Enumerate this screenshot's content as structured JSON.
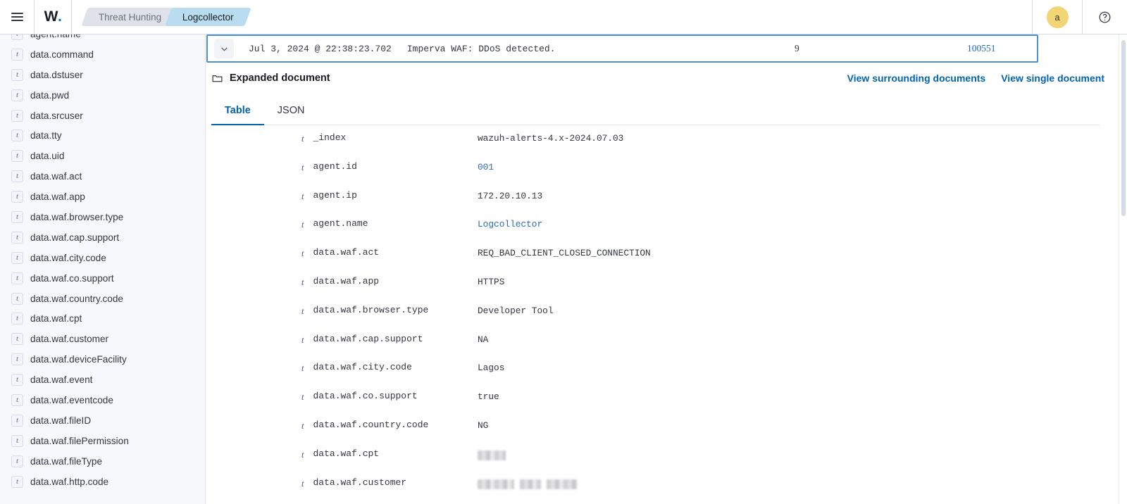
{
  "topbar": {
    "menu_icon": "hamburger-icon",
    "logo_text": "W",
    "logo_dot": ".",
    "breadcrumbs": [
      {
        "label": "Threat Hunting",
        "active": false
      },
      {
        "label": "Logcollector",
        "active": true
      }
    ],
    "avatar_initial": "a",
    "help_icon": "help-circle-icon"
  },
  "sidebar": {
    "fields": [
      {
        "type": "t",
        "name": "agent.name"
      },
      {
        "type": "t",
        "name": "data.command"
      },
      {
        "type": "t",
        "name": "data.dstuser"
      },
      {
        "type": "t",
        "name": "data.pwd"
      },
      {
        "type": "t",
        "name": "data.srcuser"
      },
      {
        "type": "t",
        "name": "data.tty"
      },
      {
        "type": "t",
        "name": "data.uid"
      },
      {
        "type": "t",
        "name": "data.waf.act"
      },
      {
        "type": "t",
        "name": "data.waf.app"
      },
      {
        "type": "t",
        "name": "data.waf.browser.type"
      },
      {
        "type": "t",
        "name": "data.waf.cap.support"
      },
      {
        "type": "t",
        "name": "data.waf.city.code"
      },
      {
        "type": "t",
        "name": "data.waf.co.support"
      },
      {
        "type": "t",
        "name": "data.waf.country.code"
      },
      {
        "type": "t",
        "name": "data.waf.cpt"
      },
      {
        "type": "t",
        "name": "data.waf.customer"
      },
      {
        "type": "t",
        "name": "data.waf.deviceFacility"
      },
      {
        "type": "t",
        "name": "data.waf.event"
      },
      {
        "type": "t",
        "name": "data.waf.eventcode"
      },
      {
        "type": "t",
        "name": "data.waf.fileID"
      },
      {
        "type": "t",
        "name": "data.waf.filePermission"
      },
      {
        "type": "t",
        "name": "data.waf.fileType"
      },
      {
        "type": "t",
        "name": "data.waf.http.code"
      }
    ]
  },
  "main": {
    "doc_row": {
      "expand_icon": "chevron-down-icon",
      "timestamp": "Jul 3, 2024 @ 22:38:23.702",
      "message": "Imperva WAF: DDoS detected.",
      "count": "9",
      "id": "100551"
    },
    "expanded": {
      "folder_icon": "folder-icon",
      "title": "Expanded document",
      "links": [
        "View surrounding documents",
        "View single document"
      ]
    },
    "tabs": [
      {
        "label": "Table",
        "active": true
      },
      {
        "label": "JSON",
        "active": false
      }
    ],
    "table_rows": [
      {
        "type": "t",
        "field": "_index",
        "value": "wazuh-alerts-4.x-2024.07.03",
        "style": "plain"
      },
      {
        "type": "t",
        "field": "agent.id",
        "value": "001",
        "style": "link"
      },
      {
        "type": "t",
        "field": "agent.ip",
        "value": "172.20.10.13",
        "style": "plain"
      },
      {
        "type": "t",
        "field": "agent.name",
        "value": "Logcollector",
        "style": "link"
      },
      {
        "type": "t",
        "field": "data.waf.act",
        "value": "REQ_BAD_CLIENT_CLOSED_CONNECTION",
        "style": "plain"
      },
      {
        "type": "t",
        "field": "data.waf.app",
        "value": "HTTPS",
        "style": "plain"
      },
      {
        "type": "t",
        "field": "data.waf.browser.type",
        "value": "Developer Tool",
        "style": "plain"
      },
      {
        "type": "t",
        "field": "data.waf.cap.support",
        "value": "NA",
        "style": "plain"
      },
      {
        "type": "t",
        "field": "data.waf.city.code",
        "value": "Lagos",
        "style": "plain"
      },
      {
        "type": "t",
        "field": "data.waf.co.support",
        "value": "true",
        "style": "plain"
      },
      {
        "type": "t",
        "field": "data.waf.country.code",
        "value": "NG",
        "style": "plain"
      },
      {
        "type": "t",
        "field": "data.waf.cpt",
        "value": "",
        "style": "redacted",
        "blocks": [
          40
        ]
      },
      {
        "type": "t",
        "field": "data.waf.customer",
        "value": "",
        "style": "redacted",
        "blocks": [
          52,
          30,
          44
        ]
      }
    ]
  },
  "colors": {
    "accent_blue": "#0263b0",
    "link_blue": "#2a6fb5",
    "highlight_border": "#4a8fe0",
    "avatar_yellow": "#f2d574",
    "crumb_active": "#b8dcf0",
    "crumb_inactive": "#dfe2ea"
  }
}
